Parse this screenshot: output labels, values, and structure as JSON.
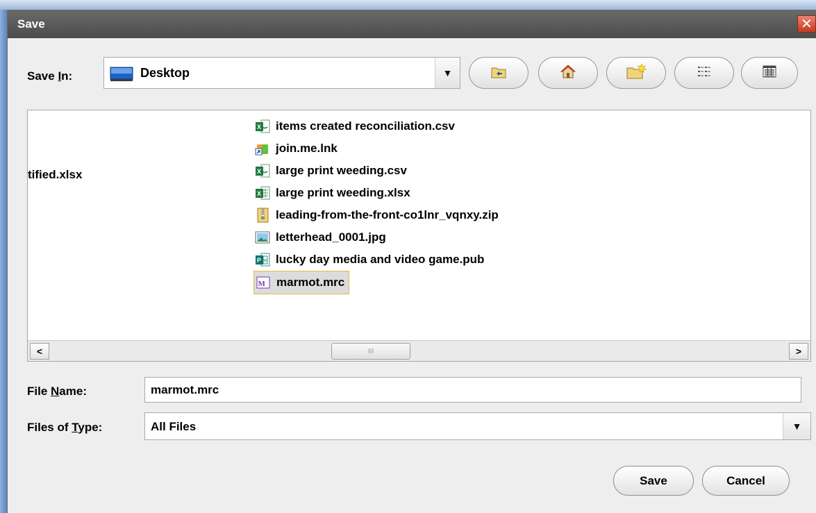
{
  "dialog": {
    "title": "Save",
    "close_glyph": "✕"
  },
  "save_in": {
    "label_prefix": "Save ",
    "label_mnemonic": "I",
    "label_suffix": "n:",
    "value": "Desktop",
    "arrow": "▼"
  },
  "toolbar": [
    {
      "name": "up-one-level-icon"
    },
    {
      "name": "home-icon"
    },
    {
      "name": "create-new-folder-icon"
    },
    {
      "name": "list-view-icon"
    },
    {
      "name": "details-view-icon"
    }
  ],
  "file_list": {
    "left_column_partial": "tified.xlsx",
    "items": [
      {
        "name": "items created reconciliation.csv",
        "icon": "excel-csv-icon"
      },
      {
        "name": "join.me.lnk",
        "icon": "shortcut-icon"
      },
      {
        "name": "large print weeding.csv",
        "icon": "excel-csv-icon"
      },
      {
        "name": "large print weeding.xlsx",
        "icon": "excel-xlsx-icon"
      },
      {
        "name": "leading-from-the-front-co1lnr_vqnxy.zip",
        "icon": "zip-icon"
      },
      {
        "name": "letterhead_0001.jpg",
        "icon": "image-icon"
      },
      {
        "name": "lucky day media and video game.pub",
        "icon": "publisher-icon"
      },
      {
        "name": "marmot.mrc",
        "icon": "marc-file-icon",
        "selected": true
      }
    ],
    "scroll_left": "<",
    "scroll_right": ">",
    "thumb_grip": "III"
  },
  "file_name": {
    "label_prefix": "File ",
    "label_mnemonic": "N",
    "label_suffix": "ame:",
    "value": "marmot.mrc"
  },
  "file_type": {
    "label_prefix": "Files of ",
    "label_mnemonic": "T",
    "label_suffix": "ype:",
    "value": "All Files",
    "arrow": "▼"
  },
  "buttons": {
    "save": "Save",
    "cancel": "Cancel"
  },
  "colors": {
    "title_bar": "#555555",
    "close": "#d9472b",
    "selection_border": "#e6b84a",
    "excel_green": "#1f7a3f"
  }
}
